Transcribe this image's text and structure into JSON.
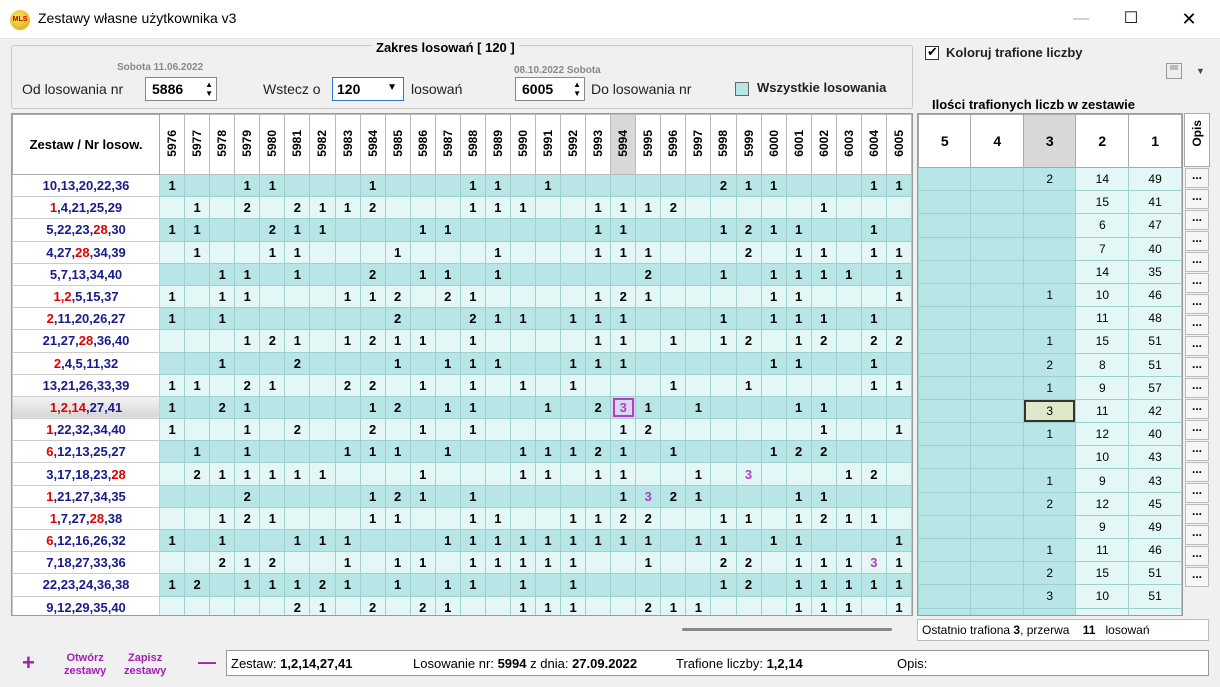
{
  "window": {
    "title": "Zestawy własne użytkownika v3",
    "app_icon_text": "MLS",
    "min": "—",
    "max": "☐",
    "close": "✕"
  },
  "range": {
    "legend": "Zakres losowań  [ 120 ]",
    "from_label": "Od losowania nr",
    "from_date": "Sobota 11.06.2022",
    "from_value": "5886",
    "back_label": "Wstecz o",
    "back_value": "120",
    "back_suffix": "losowań",
    "to_date": "08.10.2022 Sobota",
    "to_value": "6005",
    "to_label": "Do losowania nr",
    "all_label": "Wszystkie losowania"
  },
  "colorize_label": "Koloruj trafione liczby",
  "grid": {
    "corner": "Zestaw / Nr losow.",
    "selected_col": "5994",
    "selected_row": 10,
    "columns": [
      "5976",
      "5977",
      "5978",
      "5979",
      "5980",
      "5981",
      "5982",
      "5983",
      "5984",
      "5985",
      "5986",
      "5987",
      "5988",
      "5989",
      "5990",
      "5991",
      "5992",
      "5993",
      "5994",
      "5995",
      "5996",
      "5997",
      "5998",
      "5999",
      "6000",
      "6001",
      "6002",
      "6003",
      "6004",
      "6005"
    ],
    "rows": [
      {
        "set": [
          [
            "10,13,20,22,36",
            ""
          ]
        ],
        "cells": [
          "1",
          "",
          "",
          "1",
          "1",
          "",
          "",
          "",
          "1",
          "",
          "",
          "",
          "1",
          "1",
          "",
          "1",
          "",
          "",
          "",
          "",
          "",
          "",
          "2",
          "1",
          "1",
          "",
          "",
          "",
          "1",
          "1"
        ]
      },
      {
        "set": [
          [
            "1",
            "r"
          ],
          [
            ",4,21,25,29",
            ""
          ]
        ],
        "cells": [
          "",
          "1",
          "",
          "2",
          "",
          "2",
          "1",
          "1",
          "2",
          "",
          "",
          "",
          "1",
          "1",
          "1",
          "",
          "",
          "1",
          "1",
          "1",
          "2",
          "",
          "",
          "",
          "",
          "",
          "1",
          "",
          "",
          ""
        ]
      },
      {
        "set": [
          [
            "5,22,23,",
            ""
          ],
          [
            "28",
            "r"
          ],
          [
            ",30",
            ""
          ]
        ],
        "cells": [
          "1",
          "1",
          "",
          "",
          "2",
          "1",
          "1",
          "",
          "",
          "",
          "1",
          "1",
          "",
          "",
          "",
          "",
          "",
          "1",
          "1",
          "",
          "",
          "",
          "1",
          "2",
          "1",
          "1",
          "",
          "",
          "1",
          ""
        ]
      },
      {
        "set": [
          [
            "4,27,",
            ""
          ],
          [
            "28",
            "r"
          ],
          [
            ",34,39",
            ""
          ]
        ],
        "cells": [
          "",
          "1",
          "",
          "",
          "1",
          "1",
          "",
          "",
          "",
          "1",
          "",
          "",
          "",
          "1",
          "",
          "",
          "",
          "1",
          "1",
          "1",
          "",
          "",
          "",
          "2",
          "",
          "1",
          "1",
          "",
          "1",
          "1"
        ]
      },
      {
        "set": [
          [
            "5,7,13,34,40",
            ""
          ]
        ],
        "cells": [
          "",
          "",
          "1",
          "1",
          "",
          "1",
          "",
          "",
          "2",
          "",
          "1",
          "1",
          "",
          "1",
          "",
          "",
          "",
          "",
          "",
          "2",
          "",
          "",
          "1",
          "",
          "1",
          "1",
          "1",
          "1",
          "",
          "1"
        ]
      },
      {
        "set": [
          [
            "1,2",
            "r"
          ],
          [
            ",5,15,37",
            ""
          ]
        ],
        "cells": [
          "1",
          "",
          "1",
          "1",
          "",
          "",
          "",
          "1",
          "1",
          "2",
          "",
          "2",
          "1",
          "",
          "",
          "",
          "",
          "1",
          "2",
          "1",
          "",
          "",
          "",
          "",
          "1",
          "1",
          "",
          "",
          "",
          "1"
        ]
      },
      {
        "set": [
          [
            "2",
            "r"
          ],
          [
            ",11,20,26,27",
            ""
          ]
        ],
        "cells": [
          "1",
          "",
          "1",
          "",
          "",
          "",
          "",
          "",
          "",
          "2",
          "",
          "",
          "2",
          "1",
          "1",
          "",
          "1",
          "1",
          "1",
          "",
          "",
          "",
          "1",
          "",
          "1",
          "1",
          "1",
          "",
          "1",
          ""
        ]
      },
      {
        "set": [
          [
            "21,27,",
            ""
          ],
          [
            "28",
            "r"
          ],
          [
            ",36,40",
            ""
          ]
        ],
        "cells": [
          "",
          "",
          "",
          "1",
          "2",
          "1",
          "",
          "1",
          "2",
          "1",
          "1",
          "",
          "1",
          "",
          "",
          "",
          "",
          "1",
          "1",
          "",
          "1",
          "",
          "1",
          "2",
          "",
          "1",
          "2",
          "",
          "2",
          "2"
        ]
      },
      {
        "set": [
          [
            "2",
            "r"
          ],
          [
            ",4,5,11,32",
            ""
          ]
        ],
        "cells": [
          "",
          "",
          "1",
          "",
          "",
          "2",
          "",
          "",
          "",
          "1",
          "",
          "1",
          "1",
          "1",
          "",
          "",
          "1",
          "1",
          "1",
          "",
          "",
          "",
          "",
          "",
          "1",
          "1",
          "",
          "",
          "1",
          ""
        ]
      },
      {
        "set": [
          [
            "13,21,26,33,39",
            ""
          ]
        ],
        "cells": [
          "1",
          "1",
          "",
          "2",
          "1",
          "",
          "",
          "2",
          "2",
          "",
          "1",
          "",
          "1",
          "",
          "1",
          "",
          "1",
          "",
          "",
          "",
          "1",
          "",
          "",
          "1",
          "",
          "",
          "",
          "",
          "1",
          "1"
        ]
      },
      {
        "set": [
          [
            "1,2,14",
            "r"
          ],
          [
            ",27,41",
            ""
          ]
        ],
        "cells": [
          "1",
          "",
          "2",
          "1",
          "",
          "",
          "",
          "",
          "1",
          "2",
          "",
          "1",
          "1",
          "",
          "",
          "1",
          "",
          "2",
          "3",
          "1",
          "",
          "1",
          "",
          "",
          "",
          "1",
          "1",
          "",
          "",
          ""
        ],
        "magenta": [
          18
        ],
        "boxed": [
          18
        ]
      },
      {
        "set": [
          [
            "1",
            "r"
          ],
          [
            ",22,32,34,40",
            ""
          ]
        ],
        "cells": [
          "1",
          "",
          "",
          "1",
          "",
          "2",
          "",
          "",
          "2",
          "",
          "1",
          "",
          "1",
          "",
          "",
          "",
          "",
          "",
          "1",
          "2",
          "",
          "",
          "",
          "",
          "",
          "",
          "1",
          "",
          "",
          "1"
        ]
      },
      {
        "set": [
          [
            "6",
            "r"
          ],
          [
            ",12,13,25,27",
            ""
          ]
        ],
        "cells": [
          "",
          "1",
          "",
          "1",
          "",
          "",
          "",
          "1",
          "1",
          "1",
          "",
          "1",
          "",
          "",
          "1",
          "1",
          "1",
          "2",
          "1",
          "",
          "1",
          "",
          "",
          "",
          "1",
          "2",
          "2",
          "",
          "",
          ""
        ]
      },
      {
        "set": [
          [
            "3,17,18,23,",
            ""
          ],
          [
            "28",
            "r"
          ]
        ],
        "cells": [
          "",
          "2",
          "1",
          "1",
          "1",
          "1",
          "1",
          "",
          "",
          "",
          "1",
          "",
          "",
          "",
          "1",
          "1",
          "",
          "1",
          "1",
          "",
          "",
          "1",
          "",
          "3",
          "",
          "",
          "",
          "1",
          "2",
          ""
        ],
        "magenta": [
          23
        ]
      },
      {
        "set": [
          [
            "1",
            "r"
          ],
          [
            ",21,27,34,35",
            ""
          ]
        ],
        "cells": [
          "",
          "",
          "",
          "2",
          "",
          "",
          "",
          "",
          "1",
          "2",
          "1",
          "",
          "1",
          "",
          "",
          "",
          "",
          "",
          "1",
          "3",
          "2",
          "1",
          "",
          "",
          "",
          "1",
          "1",
          "",
          "",
          ""
        ],
        "magenta": [
          19
        ]
      },
      {
        "set": [
          [
            "1",
            "r"
          ],
          [
            ",7,27,",
            ""
          ],
          [
            "28",
            "r"
          ],
          [
            ",38",
            ""
          ]
        ],
        "cells": [
          "",
          "",
          "1",
          "2",
          "1",
          "",
          "",
          "",
          "1",
          "1",
          "",
          "",
          "1",
          "1",
          "",
          "",
          "1",
          "1",
          "2",
          "2",
          "",
          "",
          "1",
          "1",
          "",
          "1",
          "2",
          "1",
          "1",
          ""
        ]
      },
      {
        "set": [
          [
            "6",
            "r"
          ],
          [
            ",12,16,26,32",
            ""
          ]
        ],
        "cells": [
          "1",
          "",
          "1",
          "",
          "",
          "1",
          "1",
          "1",
          "",
          "",
          "",
          "1",
          "1",
          "1",
          "1",
          "1",
          "1",
          "1",
          "1",
          "1",
          "",
          "1",
          "1",
          "",
          "1",
          "1",
          "",
          "",
          "",
          "1"
        ]
      },
      {
        "set": [
          [
            "7,18,27,33,36",
            ""
          ]
        ],
        "cells": [
          "",
          "",
          "2",
          "1",
          "2",
          "",
          "",
          "1",
          "",
          "1",
          "1",
          "",
          "1",
          "1",
          "1",
          "1",
          "1",
          "",
          "",
          "1",
          "",
          "",
          "2",
          "2",
          "",
          "1",
          "1",
          "1",
          "3",
          "1"
        ],
        "magenta": [
          28
        ]
      },
      {
        "set": [
          [
            "22,23,24,36,38",
            ""
          ]
        ],
        "cells": [
          "1",
          "2",
          "",
          "1",
          "1",
          "1",
          "2",
          "1",
          "",
          "1",
          "",
          "1",
          "1",
          "",
          "1",
          "",
          "1",
          "",
          "",
          "",
          "",
          "",
          "1",
          "2",
          "",
          "1",
          "1",
          "1",
          "1",
          "1"
        ]
      },
      {
        "set": [
          [
            "9,12,29,35,40",
            ""
          ]
        ],
        "cells": [
          "",
          "",
          "",
          "",
          "",
          "2",
          "1",
          "",
          "2",
          "",
          "2",
          "1",
          "",
          "",
          "1",
          "1",
          "1",
          "",
          "",
          "2",
          "1",
          "1",
          "",
          "",
          "",
          "1",
          "1",
          "1",
          "",
          "1"
        ]
      }
    ]
  },
  "side": {
    "title": "Ilości trafionych liczb w zestawie",
    "headers": [
      "5",
      "4",
      "3",
      "2",
      "1"
    ],
    "opis_header": "Opis",
    "opis_btn": "...",
    "rows": [
      [
        "",
        "",
        "2",
        "14",
        "49"
      ],
      [
        "",
        "",
        "",
        "15",
        "41"
      ],
      [
        "",
        "",
        "",
        "6",
        "47"
      ],
      [
        "",
        "",
        "",
        "7",
        "40"
      ],
      [
        "",
        "",
        "",
        "14",
        "35"
      ],
      [
        "",
        "",
        "1",
        "10",
        "46"
      ],
      [
        "",
        "",
        "",
        "11",
        "48"
      ],
      [
        "",
        "",
        "1",
        "15",
        "51"
      ],
      [
        "",
        "",
        "2",
        "8",
        "51"
      ],
      [
        "",
        "",
        "1",
        "9",
        "57"
      ],
      [
        "",
        "",
        "3",
        "11",
        "42"
      ],
      [
        "",
        "",
        "1",
        "12",
        "40"
      ],
      [
        "",
        "",
        "",
        "10",
        "43"
      ],
      [
        "",
        "",
        "1",
        "9",
        "43"
      ],
      [
        "",
        "",
        "2",
        "12",
        "45"
      ],
      [
        "",
        "",
        "",
        "9",
        "49"
      ],
      [
        "",
        "",
        "1",
        "11",
        "46"
      ],
      [
        "",
        "",
        "2",
        "15",
        "51"
      ],
      [
        "",
        "",
        "3",
        "10",
        "51"
      ],
      [
        "",
        "",
        "",
        "11",
        "46"
      ]
    ],
    "footer_prefix": "Ostatnio trafiona",
    "footer_hit": "3",
    "footer_mid": ", przerwa",
    "footer_gap": "11",
    "footer_suffix": "losowań"
  },
  "bottom": {
    "plus": "+",
    "open_l1": "Otwórz",
    "open_l2": "zestawy",
    "save_l1": "Zapisz",
    "save_l2": "zestawy",
    "minus": "—",
    "status": {
      "set_label": "Zestaw:",
      "set_value": "1,2,14,27,41",
      "draw_label": "Losowanie nr:",
      "draw_value": "5994",
      "date_label": "z dnia:",
      "date_value": "27.09.2022",
      "hits_label": "Trafione liczby:",
      "hits_value": "1,2,14",
      "opis_label": "Opis:"
    }
  }
}
